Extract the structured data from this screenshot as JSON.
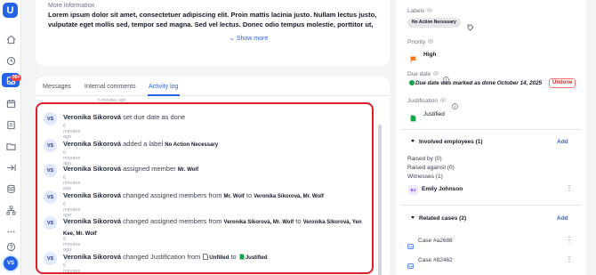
{
  "rail": {
    "logo_letter": "U",
    "badge": "99+",
    "avatar_initials": "VS",
    "icons": [
      "home-icon",
      "clock-icon",
      "inbox-icon",
      "calendar-icon",
      "list-icon",
      "folder-icon",
      "share-icon",
      "database-icon",
      "org-icon",
      "more-icon",
      "help-icon"
    ]
  },
  "info": {
    "title": "More information",
    "text": "Lorem ipsum dolor sit amet, consectetuer adipiscing elit. Proin mattis lacinia justo. Nullam lectus justo, vulputate eget mollis sed, tempor sed magna. Sed vel lectus. Donec odio tempus molestie, porttitor ut, iaculis quis, sem. In rutrum. Morbi leo mi, nonummy eget tristique non, rhoncus non leo. Ut tempus purus at lorem.",
    "show_more": "Show more"
  },
  "tabs": [
    {
      "label": "Messages"
    },
    {
      "label": "Internal comments"
    },
    {
      "label": "Activity log"
    }
  ],
  "activity": {
    "ghost_time": "6 minutes ago",
    "entries": [
      {
        "initials": "VS",
        "user": "Veronika Sikorová",
        "action": "set due date as done",
        "time": "6 minutes ago"
      },
      {
        "initials": "VS",
        "user": "Veronika Sikorová",
        "action": "added a label",
        "value": "No Action Necessary",
        "time": "6 minutes ago"
      },
      {
        "initials": "VS",
        "user": "Veronika Sikorová",
        "action": "assigned member",
        "value": "Mr. Wolf",
        "time": "6 minutes ago"
      },
      {
        "initials": "VS",
        "user": "Veronika Sikorová",
        "action": "changed assigned members from",
        "from": "Mr. Wolf",
        "to_word": "to",
        "to": "Veronika Sikorová, Mr. Wolf",
        "time": "6 minutes ago"
      },
      {
        "initials": "VS",
        "user": "Veronika Sikorová",
        "action": "changed assigned members from",
        "from": "Veronika Sikorová, Mr. Wolf",
        "to_word": "to",
        "to": "Veronika Sikorová, Yen Kee, Mr. Wolf",
        "time": "6 minutes ago"
      },
      {
        "initials": "VS",
        "user": "Veronika Sikorová",
        "action": "changed Justification from",
        "from": "Unfilled",
        "to_word": "to",
        "to": "Justified",
        "time": "5 minutes ago"
      }
    ]
  },
  "right": {
    "labels_title": "Labels",
    "label_chip": "No Action Necessary",
    "priority_title": "Priority",
    "priority_value": "High",
    "due_title": "Due date",
    "due_text": "Due date was marked as done October 14, 2025",
    "undone": "Undone",
    "justification_title": "Justification",
    "justification_value": "Justified",
    "involved_title": "Involved employees (1)",
    "add_label": "Add",
    "raised_by": "Raised by (0)",
    "raised_against": "Raised against (0)",
    "witnesses": "Witnesses (1)",
    "employee_initials": "EJ",
    "employee_name": "Emily Johnson",
    "related_title": "Related cases (2)",
    "cases": [
      "Case #a2688",
      "Case #82462"
    ]
  },
  "colors": {
    "accent": "#2563eb",
    "highlight": "#e11d2a",
    "priority": "#f97316",
    "due": "#16a34a"
  }
}
